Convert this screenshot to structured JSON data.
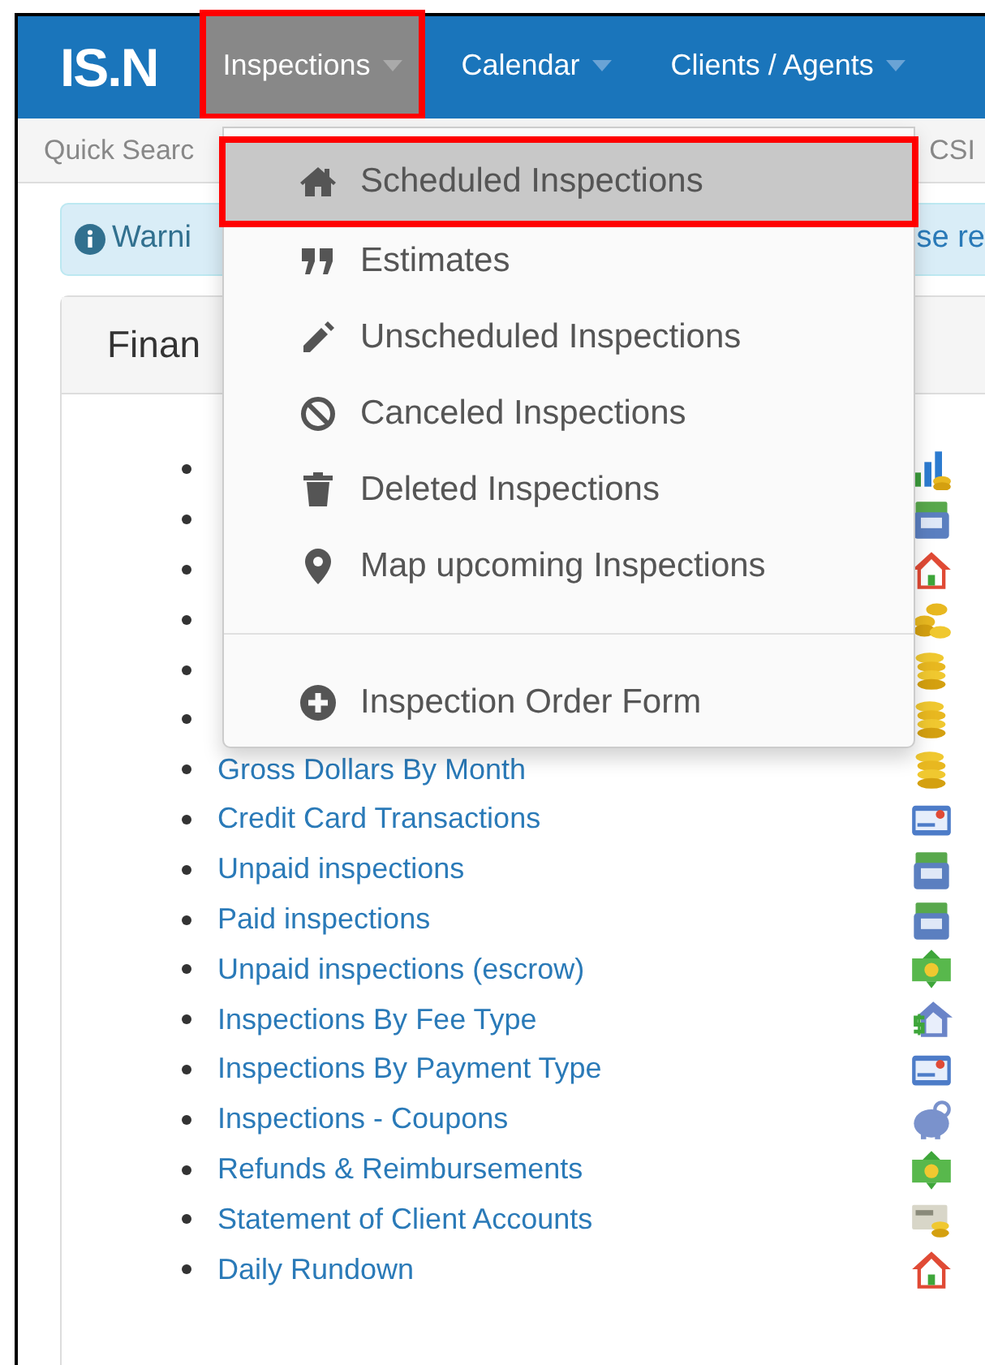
{
  "nav": {
    "logo": "IS.N",
    "menus": [
      {
        "label": "Inspections",
        "selected": true,
        "highlighted": true
      },
      {
        "label": "Calendar",
        "selected": false,
        "highlighted": false
      },
      {
        "label": "Clients / Agents",
        "selected": false,
        "highlighted": false
      }
    ]
  },
  "subbar": {
    "left": "Quick Searc",
    "right": "CSI"
  },
  "alert": {
    "left": "Warni",
    "right": "se re"
  },
  "panel": {
    "title": "Finan",
    "reports": [
      {
        "kind": "covered"
      },
      {
        "kind": "covered"
      },
      {
        "kind": "covered"
      },
      {
        "kind": "covered"
      },
      {
        "kind": "covered"
      },
      {
        "kind": "covered"
      },
      {
        "kind": "link",
        "label": "Gross Dollars By Month"
      },
      {
        "kind": "link",
        "label": "Credit Card Transactions"
      },
      {
        "kind": "link",
        "label": "Unpaid inspections"
      },
      {
        "kind": "link",
        "label": "Paid inspections"
      },
      {
        "kind": "link",
        "label": "Unpaid inspections (escrow)"
      },
      {
        "kind": "link",
        "label": "Inspections By Fee Type"
      },
      {
        "kind": "link",
        "label": "Inspections By Payment Type"
      },
      {
        "kind": "link",
        "label": "Inspections - Coupons"
      },
      {
        "kind": "link",
        "label": "Refunds & Reimbursements"
      },
      {
        "kind": "link",
        "label": "Statement of Client Accounts"
      },
      {
        "kind": "link",
        "label": "Daily Rundown"
      }
    ]
  },
  "dropdown": {
    "items": [
      {
        "kind": "link",
        "label": "Scheduled Inspections",
        "selected": true,
        "highlighted": true
      },
      {
        "kind": "link",
        "label": "Estimates",
        "selected": false,
        "highlighted": false
      },
      {
        "kind": "link",
        "label": "Unscheduled Inspections",
        "selected": false,
        "highlighted": false
      },
      {
        "kind": "link",
        "label": "Canceled Inspections",
        "selected": false,
        "highlighted": false
      },
      {
        "kind": "link",
        "label": "Deleted Inspections",
        "selected": false,
        "highlighted": false
      },
      {
        "kind": "link",
        "label": "Map upcoming Inspections",
        "selected": false,
        "highlighted": false
      },
      {
        "kind": "divider"
      },
      {
        "kind": "link",
        "label": "Inspection Order Form",
        "selected": false,
        "highlighted": false
      }
    ]
  }
}
